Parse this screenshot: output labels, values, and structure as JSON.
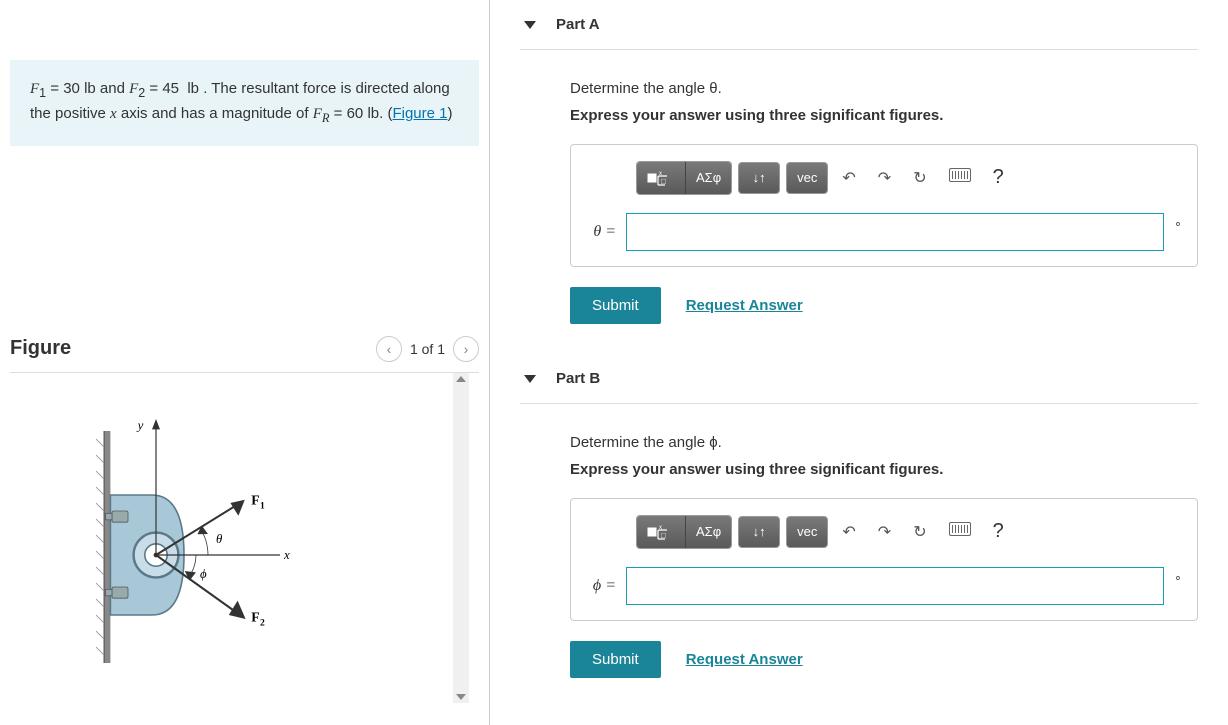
{
  "problem": {
    "html": "<span class='math'>F</span><sub>1</sub> = 30 lb and <span class='math'>F</span><sub>2</sub> = 45 &nbsp;lb . The resultant force is directed along the positive <span class='math'>x</span> axis and has a magnitude of <span class='math'>F<sub>R</sub></span> = 60 lb. (<span class='link'>Figure 1</span>)"
  },
  "figure": {
    "title": "Figure",
    "counter": "1 of 1",
    "labels": {
      "y": "y",
      "x": "x",
      "F1": "F₁",
      "F2": "F₂",
      "theta": "θ",
      "phi": "ϕ"
    }
  },
  "parts": [
    {
      "id": "A",
      "title": "Part A",
      "prompt": "Determine the angle θ.",
      "instruction": "Express your answer using three significant figures.",
      "var_label": "θ =",
      "unit": "∘",
      "value": ""
    },
    {
      "id": "B",
      "title": "Part B",
      "prompt": "Determine the angle ϕ.",
      "instruction": "Express your answer using three significant figures.",
      "var_label": "ϕ =",
      "unit": "∘",
      "value": ""
    }
  ],
  "toolbar": {
    "greek": "ΑΣφ",
    "arrows": "↓↑",
    "vec": "vec",
    "undo": "↶",
    "redo": "↷",
    "reset": "↻",
    "help": "?"
  },
  "actions": {
    "submit": "Submit",
    "request": "Request Answer"
  }
}
